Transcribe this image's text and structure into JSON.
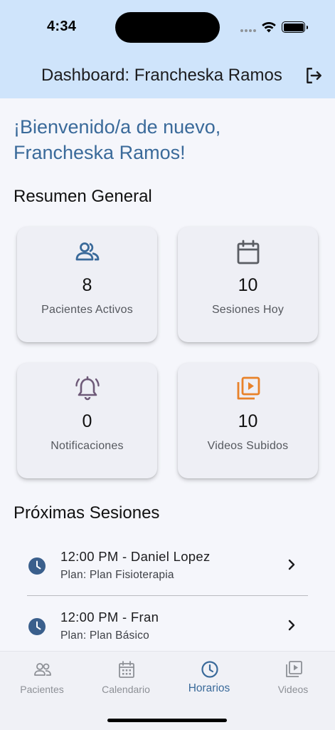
{
  "status": {
    "time": "4:34"
  },
  "header": {
    "title": "Dashboard: Francheska Ramos",
    "logout_icon": "logout-icon"
  },
  "welcome": "¡Bienvenido/a de nuevo, Francheska Ramos!",
  "summary": {
    "title": "Resumen General",
    "cards": [
      {
        "icon": "people-icon",
        "value": "8",
        "label": "Pacientes Activos",
        "color": "#3a6a9a"
      },
      {
        "icon": "calendar-icon",
        "value": "10",
        "label": "Sesiones Hoy",
        "color": "#5a5d63"
      },
      {
        "icon": "bell-icon",
        "value": "0",
        "label": "Notificaciones",
        "color": "#6e5a78"
      },
      {
        "icon": "video-library-icon",
        "value": "10",
        "label": "Videos Subidos",
        "color": "#e8822a"
      }
    ]
  },
  "sessions": {
    "title": "Próximas Sesiones",
    "items": [
      {
        "title": "12:00 PM - Daniel Lopez",
        "plan": "Plan: Plan Fisioterapia"
      },
      {
        "title": "12:00 PM - Fran",
        "plan": "Plan: Plan Básico"
      }
    ]
  },
  "nav": {
    "items": [
      {
        "label": "Pacientes",
        "icon": "people-icon"
      },
      {
        "label": "Calendario",
        "icon": "calendar-icon"
      },
      {
        "label": "Horarios",
        "icon": "clock-icon",
        "active": true
      },
      {
        "label": "Videos",
        "icon": "video-library-icon"
      }
    ]
  },
  "colors": {
    "accent": "#3a6a9a",
    "header_bg": "#cfe4fb",
    "page_bg": "#f5f6fb"
  }
}
